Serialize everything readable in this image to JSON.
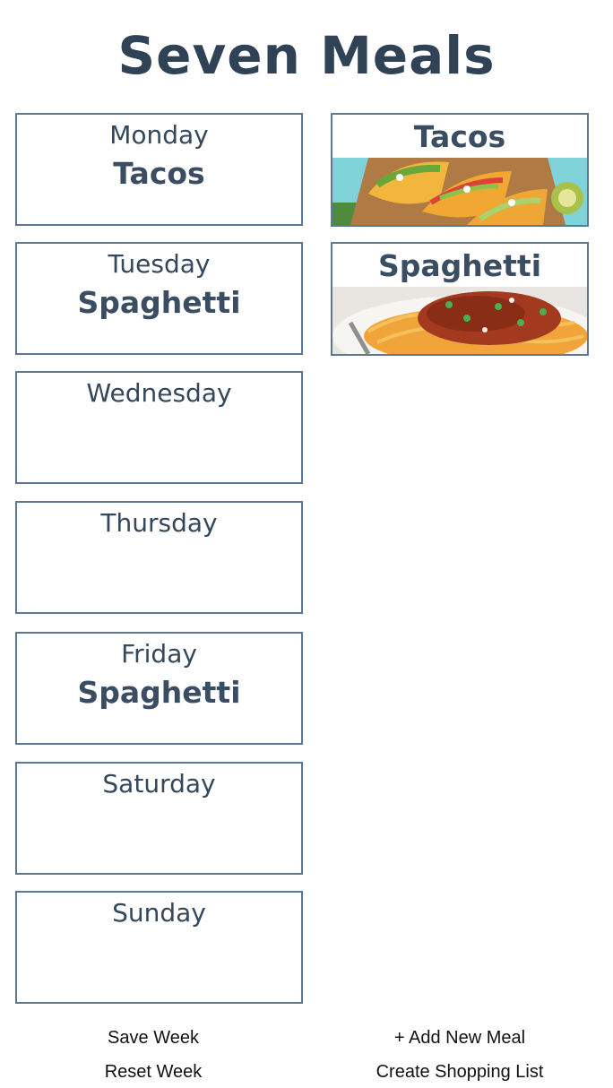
{
  "app": {
    "title": "Seven Meals"
  },
  "week": [
    {
      "day": "Monday",
      "meal": "Tacos"
    },
    {
      "day": "Tuesday",
      "meal": "Spaghetti"
    },
    {
      "day": "Wednesday",
      "meal": ""
    },
    {
      "day": "Thursday",
      "meal": ""
    },
    {
      "day": "Friday",
      "meal": "Spaghetti"
    },
    {
      "day": "Saturday",
      "meal": ""
    },
    {
      "day": "Sunday",
      "meal": ""
    }
  ],
  "meals": [
    {
      "name": "Tacos",
      "image": "tacos-photo"
    },
    {
      "name": "Spaghetti",
      "image": "spaghetti-photo"
    }
  ],
  "footer": {
    "save_week": "Save Week",
    "reset_week": "Reset Week",
    "add_meal": "+ Add New Meal",
    "shopping_list": "Create Shopping List"
  },
  "colors": {
    "text": "#34475b",
    "border": "#5d7896",
    "background": "#ffffff"
  }
}
